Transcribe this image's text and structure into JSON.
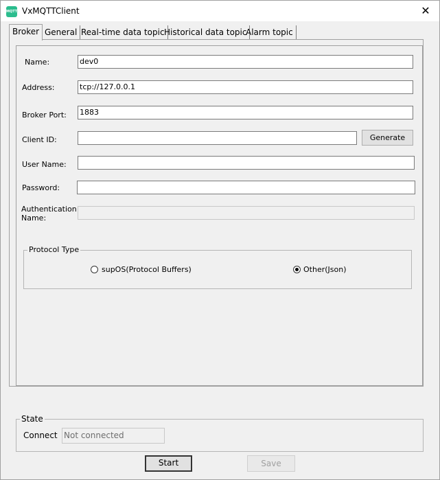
{
  "window": {
    "title": "VxMQTTClient",
    "app_icon_text": "MQTT",
    "close_glyph": "✕"
  },
  "tabs": [
    {
      "label": "Broker",
      "active": true
    },
    {
      "label": "General",
      "active": false
    },
    {
      "label": "Real-time data topic",
      "active": false
    },
    {
      "label": "Historical data topic",
      "active": false
    },
    {
      "label": "Alarm topic",
      "active": false
    }
  ],
  "broker": {
    "name_label": "Name:",
    "name_value": "dev0",
    "address_label": "Address:",
    "address_value": "tcp://127.0.0.1",
    "port_label": "Broker Port:",
    "port_value": "1883",
    "client_id_label": "Client ID:",
    "client_id_value": "",
    "generate_label": "Generate",
    "user_label": "User Name:",
    "user_value": "",
    "password_label": "Password:",
    "password_value": "",
    "auth_label_line1": "Authentication",
    "auth_label_line2": "Name:",
    "auth_value": ""
  },
  "protocol": {
    "title": "Protocol Type",
    "option_supos": "supOS(Protocol Buffers)",
    "option_other": "Other(Json)",
    "selected": "Other(Json)"
  },
  "state": {
    "title": "State",
    "connect_label": "Connect",
    "connect_value": "Not connected"
  },
  "actions": {
    "start_label": "Start",
    "save_label": "Save"
  }
}
